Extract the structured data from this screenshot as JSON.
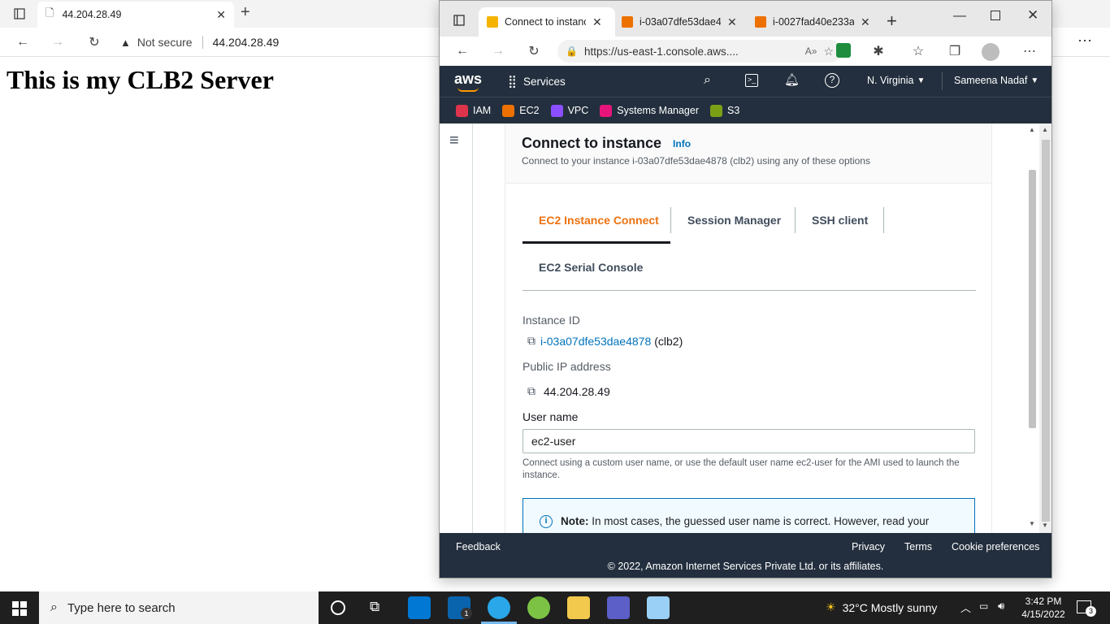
{
  "bg_browser": {
    "tab_title": "44.204.28.49",
    "security_label": "Not secure",
    "url": "44.204.28.49",
    "page_heading": "This is my CLB2 Server"
  },
  "front_browser": {
    "tabs": [
      {
        "label": "Connect to instanc"
      },
      {
        "label": "i-03a07dfe53dae4"
      },
      {
        "label": "i-0027fad40e233a"
      }
    ],
    "url": "https://us-east-1.console.aws...."
  },
  "aws_header": {
    "logo": "aws",
    "services_label": "Services",
    "region": "N. Virginia",
    "user": "Sameena Nadaf",
    "favorites": [
      {
        "label": "IAM",
        "color": "#dd344c"
      },
      {
        "label": "EC2",
        "color": "#ed7100"
      },
      {
        "label": "VPC",
        "color": "#8c4fff"
      },
      {
        "label": "Systems Manager",
        "color": "#e7157b"
      },
      {
        "label": "S3",
        "color": "#7aa116"
      }
    ]
  },
  "main": {
    "title": "Connect to instance",
    "info_link": "Info",
    "subtitle": "Connect to your instance i-03a07dfe53dae4878 (clb2) using any of these options",
    "tabs": [
      {
        "label": "EC2 Instance Connect",
        "active": true
      },
      {
        "label": "Session Manager"
      },
      {
        "label": "SSH client"
      },
      {
        "label": "EC2 Serial Console"
      }
    ],
    "instance_id_label": "Instance ID",
    "instance_id": "i-03a07dfe53dae4878",
    "instance_name": "(clb2)",
    "public_ip_label": "Public IP address",
    "public_ip": "44.204.28.49",
    "username_label": "User name",
    "username_value": "ec2-user",
    "username_hint": "Connect using a custom user name, or use the default user name ec2-user for the AMI used to launch the instance.",
    "note_bold": "Note:",
    "note_text": "In most cases, the guessed user name is correct. However, read your"
  },
  "footer": {
    "feedback": "Feedback",
    "privacy": "Privacy",
    "terms": "Terms",
    "cookies": "Cookie preferences",
    "copyright": "© 2022, Amazon Internet Services Private Ltd. or its affiliates."
  },
  "taskbar": {
    "search_placeholder": "Type here to search",
    "mail_badge": "1",
    "weather": "32°C  Mostly sunny",
    "time": "3:42 PM",
    "date": "4/15/2022",
    "notif_count": "3"
  },
  "colors": {
    "aws_dark": "#232f3e",
    "aws_orange": "#ec7211",
    "link_blue": "#0073bb"
  }
}
